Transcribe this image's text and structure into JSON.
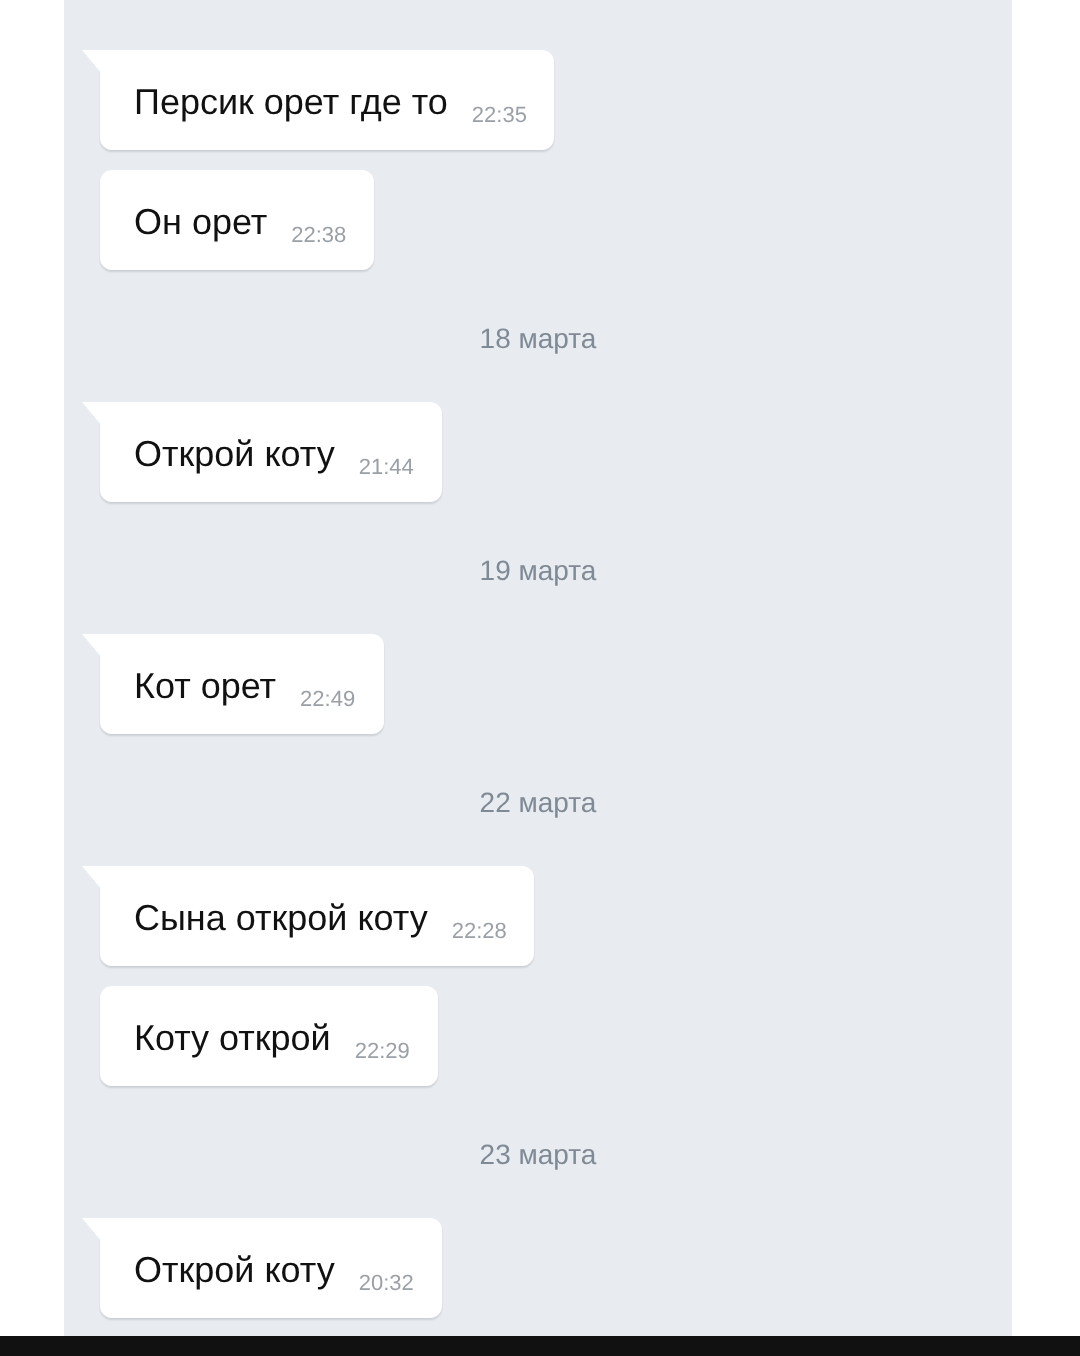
{
  "messages": [
    {
      "kind": "message",
      "text": "Персик орет где то",
      "time": "22:35",
      "tail": true
    },
    {
      "kind": "message",
      "text": "Он орет",
      "time": "22:38",
      "tail": false
    },
    {
      "kind": "date",
      "text": "18 марта"
    },
    {
      "kind": "message",
      "text": "Открой коту",
      "time": "21:44",
      "tail": true
    },
    {
      "kind": "date",
      "text": "19 марта"
    },
    {
      "kind": "message",
      "text": "Кот орет",
      "time": "22:49",
      "tail": true
    },
    {
      "kind": "date",
      "text": "22 марта"
    },
    {
      "kind": "message",
      "text": "Сына открой коту",
      "time": "22:28",
      "tail": true
    },
    {
      "kind": "message",
      "text": "Коту открой",
      "time": "22:29",
      "tail": false
    },
    {
      "kind": "date",
      "text": "23 марта"
    },
    {
      "kind": "message",
      "text": "Открой коту",
      "time": "20:32",
      "tail": true
    }
  ]
}
